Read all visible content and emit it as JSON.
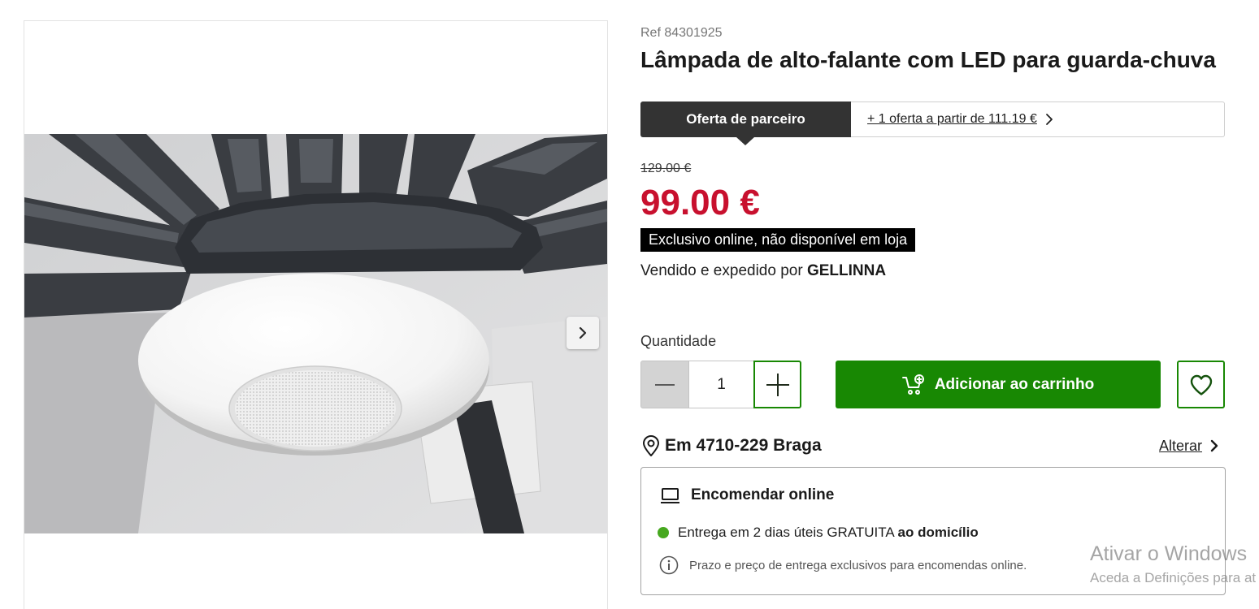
{
  "product": {
    "ref": "Ref 84301925",
    "title": "Lâmpada de alto-falante com LED para guarda-chuva"
  },
  "offer_tabs": {
    "active_label": "Oferta de parceiro",
    "other_label": "+ 1 oferta a partir de 111.19 €"
  },
  "price": {
    "old": "129.00 €",
    "current": "99.00 €",
    "badge": "Exclusivo online, não disponível em loja"
  },
  "seller": {
    "prefix": "Vendido e expedido por",
    "name": "GELLINNA"
  },
  "quantity": {
    "label": "Quantidade",
    "value": "1"
  },
  "cart": {
    "add_label": "Adicionar ao carrinho"
  },
  "location": {
    "text": "Em 4710-229 Braga",
    "change_label": "Alterar"
  },
  "delivery": {
    "heading": "Encomendar online",
    "line_regular": "Entrega em 2 dias úteis GRATUITA",
    "line_bold": "ao domicílio",
    "note": "Prazo e preço de entrega exclusivos para encomendas online."
  },
  "watermark": {
    "line1": "Ativar o Windows",
    "line2": "Aceda a Definições para at"
  },
  "icons": {
    "next_image": "chevron-right-icon",
    "other_offers": "chevron-right-icon",
    "decrease": "minus-icon",
    "increase": "plus-icon",
    "cart": "cart-add-icon",
    "wishlist": "heart-icon",
    "location": "location-pin-icon",
    "change_location": "chevron-right-icon",
    "online_order": "laptop-icon",
    "delivery_status": "status-dot",
    "info": "info-icon"
  },
  "colors": {
    "accent_green": "#188803",
    "price_red": "#c8102e",
    "tab_dark": "#333333",
    "status_green": "#46a81f"
  }
}
